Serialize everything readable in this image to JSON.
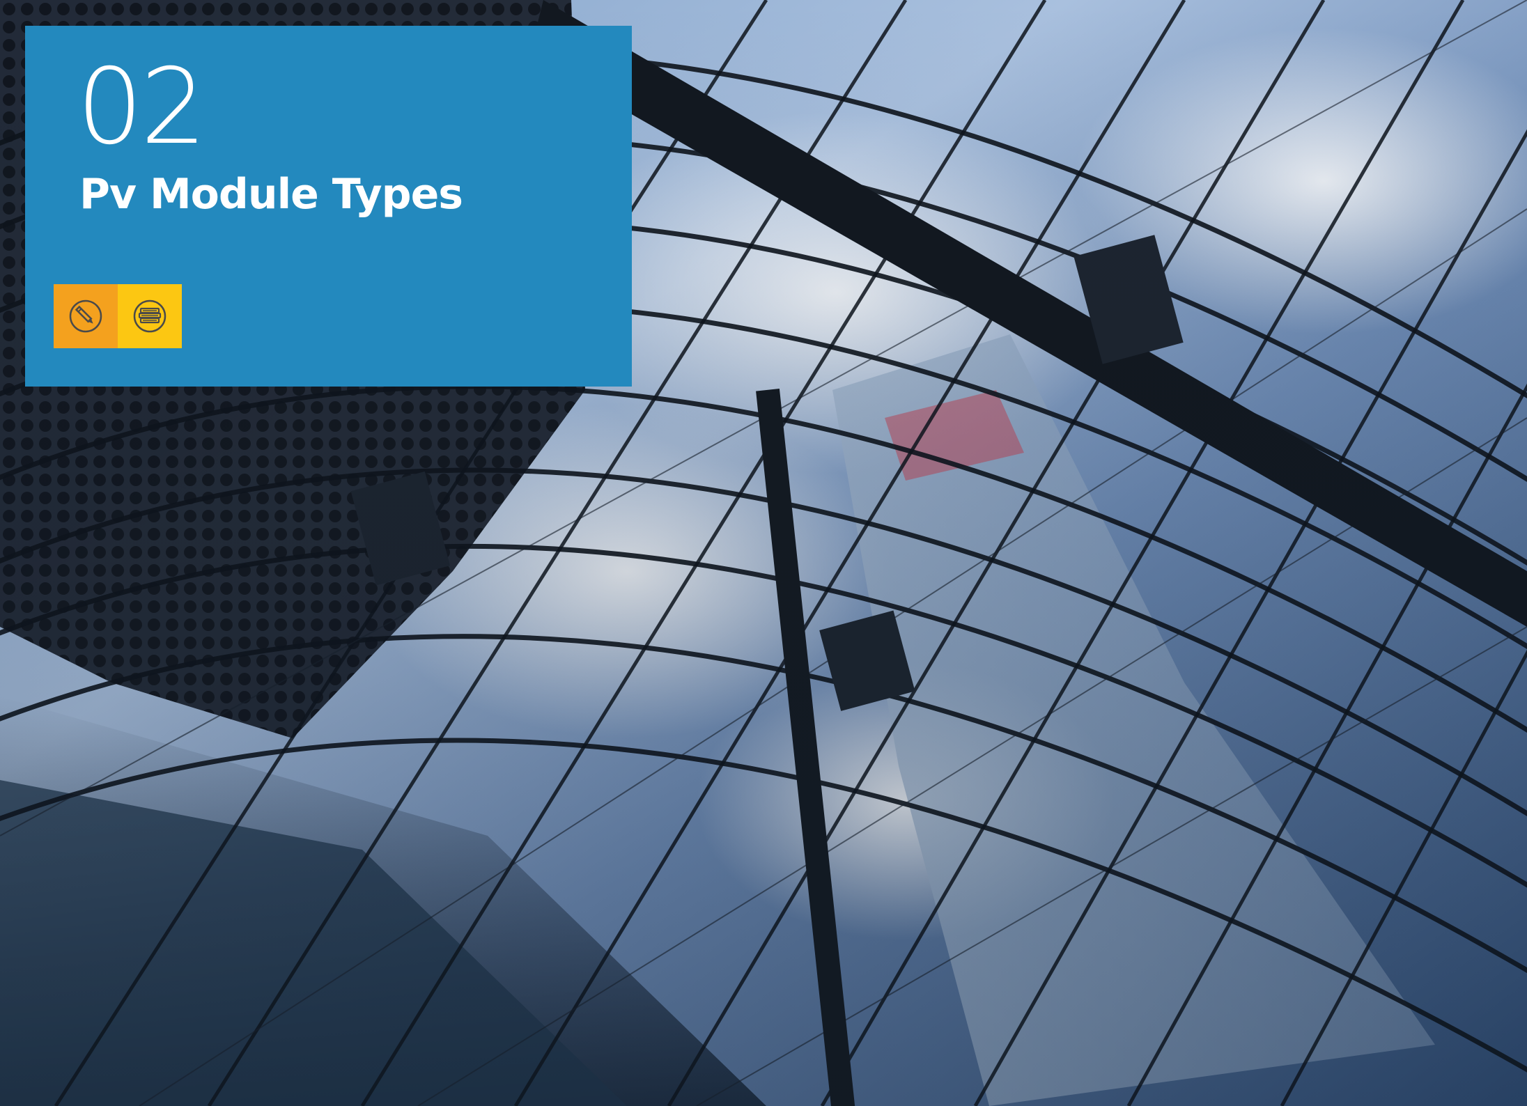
{
  "chapter": {
    "number": "02",
    "title": "Pv Module Types"
  },
  "icons": [
    {
      "name": "pencil-icon",
      "background": "#f4a11e"
    },
    {
      "name": "books-icon",
      "background": "#fcc712"
    }
  ],
  "colors": {
    "panel": "#2389be",
    "icon_line": "#4a4a4a"
  }
}
